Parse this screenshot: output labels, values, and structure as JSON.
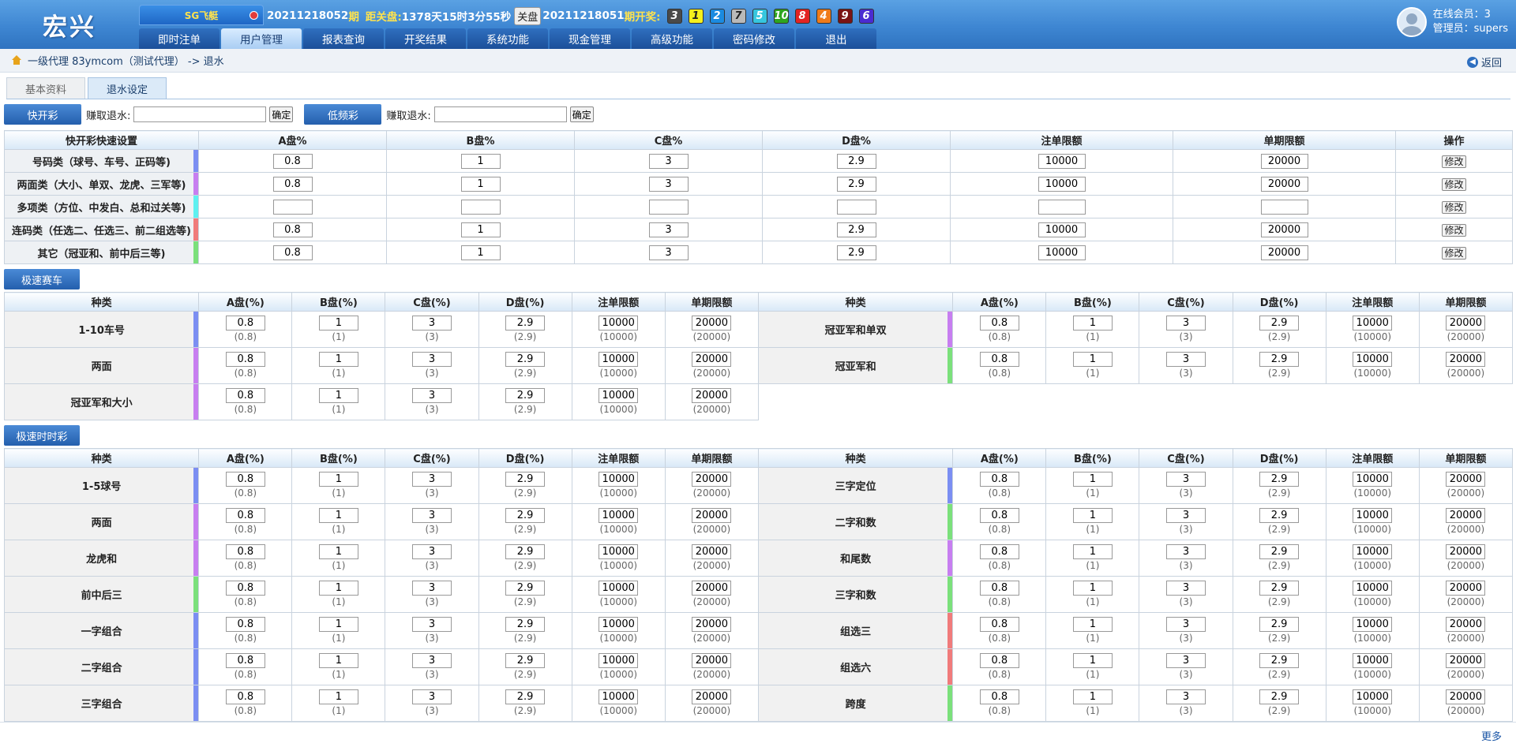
{
  "header": {
    "logo": "宏兴",
    "game": "SG飞艇",
    "period_current": "20211218052",
    "period_suffix": "期",
    "close_label": "距关盘:",
    "countdown": "1378天15时3分55秒",
    "close_button": "关盘",
    "period_last": "20211218051",
    "last_label": "期开奖:",
    "balls": [
      {
        "n": "3",
        "bg": "#4a4a4a",
        "fg": "#fff"
      },
      {
        "n": "1",
        "bg": "#f5f01c",
        "fg": "#222"
      },
      {
        "n": "2",
        "bg": "#1b8be0",
        "fg": "#fff"
      },
      {
        "n": "7",
        "bg": "#b9b9b9",
        "fg": "#222"
      },
      {
        "n": "5",
        "bg": "#36c6de",
        "fg": "#fff"
      },
      {
        "n": "10",
        "bg": "#2ea51f",
        "fg": "#fff"
      },
      {
        "n": "8",
        "bg": "#e22323",
        "fg": "#fff"
      },
      {
        "n": "4",
        "bg": "#ef7b1a",
        "fg": "#fff"
      },
      {
        "n": "9",
        "bg": "#7a1414",
        "fg": "#fff"
      },
      {
        "n": "6",
        "bg": "#4b2bd1",
        "fg": "#fff"
      }
    ],
    "nav": [
      "即时注单",
      "用户管理",
      "报表查询",
      "开奖结果",
      "系统功能",
      "现金管理",
      "高级功能",
      "密码修改",
      "退出"
    ],
    "nav_active": 1,
    "online_label": "在线会员：3",
    "admin_label": "管理员：supers"
  },
  "breadcrumb": {
    "text": "一级代理 83ymcom（测试代理） -> 退水",
    "back": "返回"
  },
  "tabs": [
    "基本资料",
    "退水设定"
  ],
  "tab_active": 1,
  "quick": {
    "fast_label": "快开彩",
    "earn_label": "赚取退水:",
    "ok": "确定",
    "slow_label": "低频彩"
  },
  "table1": {
    "headers": [
      "快开彩快速设置",
      "A盘%",
      "B盘%",
      "C盘%",
      "D盘%",
      "注单限额",
      "单期限额",
      "操作"
    ],
    "rows": [
      {
        "name": "号码类（球号、车号、正码等)",
        "color": "#7b8ef2",
        "vals": [
          "0.8",
          "1",
          "3",
          "2.9",
          "10000",
          "20000"
        ]
      },
      {
        "name": "两面类（大小、单双、龙虎、三军等)",
        "color": "#c77ef0",
        "vals": [
          "0.8",
          "1",
          "3",
          "2.9",
          "10000",
          "20000"
        ]
      },
      {
        "name": "多项类（方位、中发白、总和过关等)",
        "color": "#5ef0f0",
        "vals": [
          "",
          "",
          "",
          "",
          "",
          ""
        ]
      },
      {
        "name": "连码类（任选二、任选三、前二组选等)",
        "color": "#f07b7b",
        "vals": [
          "0.8",
          "1",
          "3",
          "2.9",
          "10000",
          "20000"
        ]
      },
      {
        "name": "其它（冠亚和、前中后三等)",
        "color": "#7be07b",
        "vals": [
          "0.8",
          "1",
          "3",
          "2.9",
          "10000",
          "20000"
        ]
      }
    ],
    "edit": "修改"
  },
  "section2": {
    "title": "极速赛车",
    "headers": [
      "种类",
      "A盘(%)",
      "B盘(%)",
      "C盘(%)",
      "D盘(%)",
      "注单限额",
      "单期限额"
    ],
    "left": [
      {
        "name": "1-10车号",
        "color": "#7b8ef2"
      },
      {
        "name": "两面",
        "color": "#c77ef0"
      },
      {
        "name": "冠亚军和大小",
        "color": "#c77ef0"
      }
    ],
    "right": [
      {
        "name": "冠亚军和单双",
        "color": "#c77ef0"
      },
      {
        "name": "冠亚军和",
        "color": "#7be07b"
      }
    ]
  },
  "section3": {
    "title": "极速时时彩",
    "headers": [
      "种类",
      "A盘(%)",
      "B盘(%)",
      "C盘(%)",
      "D盘(%)",
      "注单限额",
      "单期限额"
    ],
    "left": [
      {
        "name": "1-5球号",
        "color": "#7b8ef2"
      },
      {
        "name": "两面",
        "color": "#c77ef0"
      },
      {
        "name": "龙虎和",
        "color": "#c77ef0"
      },
      {
        "name": "前中后三",
        "color": "#7be07b"
      },
      {
        "name": "一字组合",
        "color": "#7b8ef2"
      },
      {
        "name": "二字组合",
        "color": "#7b8ef2"
      },
      {
        "name": "三字组合",
        "color": "#7b8ef2"
      }
    ],
    "right": [
      {
        "name": "三字定位",
        "color": "#7b8ef2"
      },
      {
        "name": "二字和数",
        "color": "#7be07b"
      },
      {
        "name": "和尾数",
        "color": "#c77ef0"
      },
      {
        "name": "三字和数",
        "color": "#7be07b"
      },
      {
        "name": "组选三",
        "color": "#f07b7b"
      },
      {
        "name": "组选六",
        "color": "#f07b7b"
      },
      {
        "name": "跨度",
        "color": "#7be07b"
      }
    ]
  },
  "default_values": [
    "0.8",
    "1",
    "3",
    "2.9",
    "10000",
    "20000"
  ],
  "default_subs": [
    "(0.8)",
    "(1)",
    "(3)",
    "(2.9)",
    "(10000)",
    "(20000)"
  ],
  "footer": {
    "more": "更多"
  }
}
